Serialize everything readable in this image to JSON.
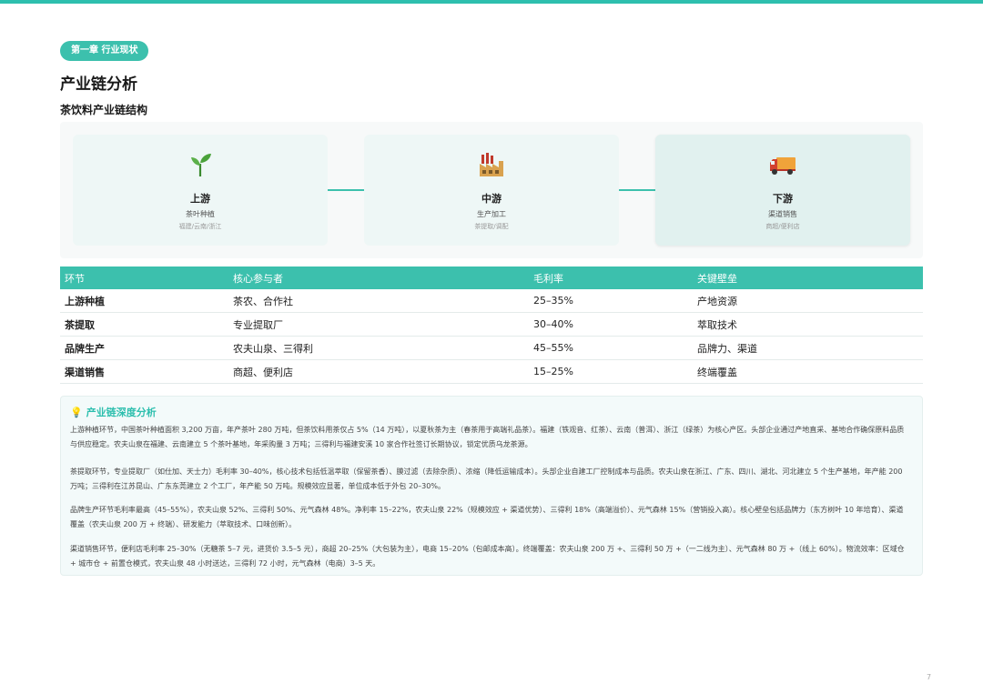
{
  "chapter_badge": "第一章 行业现状",
  "page_title": "产业链分析",
  "subtitle": "茶饮料产业链结构",
  "stages": [
    {
      "name": "上游",
      "desc": "茶叶种植",
      "regions": "福建/云南/浙江",
      "icon": "seedling-icon"
    },
    {
      "name": "中游",
      "desc": "生产加工",
      "regions": "茶提取/调配",
      "icon": "factory-icon"
    },
    {
      "name": "下游",
      "desc": "渠道销售",
      "regions": "商超/便利店",
      "icon": "delivery-truck-icon"
    }
  ],
  "table": {
    "headers": [
      "环节",
      "核心参与者",
      "毛利率",
      "关键壁垒"
    ],
    "rows": [
      [
        "上游种植",
        "茶农、合作社",
        "25–35%",
        "产地资源"
      ],
      [
        "茶提取",
        "专业提取厂",
        "30–40%",
        "萃取技术"
      ],
      [
        "品牌生产",
        "农夫山泉、三得利",
        "45–55%",
        "品牌力、渠道"
      ],
      [
        "渠道销售",
        "商超、便利店",
        "15–25%",
        "终端覆盖"
      ]
    ]
  },
  "analysis": {
    "title": "产业链深度分析",
    "paragraphs": [
      "上游种植环节，中国茶叶种植面积 3,200 万亩，年产茶叶 280 万吨，但茶饮料用茶仅占 5%（14 万吨），以夏秋茶为主（春茶用于高端礼品茶）。福建（铁观音、红茶）、云南（普洱）、浙江（绿茶）为核心产区。头部企业通过产地直采、基地合作确保原料品质与供应稳定。农夫山泉在福建、云南建立 5 个茶叶基地，年采购量 3 万吨；三得利与福建安溪 10 家合作社签订长期协议，锁定优质乌龙茶源。",
      "茶提取环节，专业提取厂（如仕加、天士力）毛利率 30–40%，核心技术包括低温萃取（保留茶香）、膜过滤（去除杂质）、浓缩（降低运输成本）。头部企业自建工厂控制成本与品质。农夫山泉在浙江、广东、四川、湖北、河北建立 5 个生产基地，年产能 200 万吨；三得利在江苏昆山、广东东莞建立 2 个工厂，年产能 50 万吨。规模效应显著，单位成本低于外包 20–30%。",
      "品牌生产环节毛利率最高（45–55%），农夫山泉 52%、三得利 50%、元气森林 48%。净利率 15–22%，农夫山泉 22%（规模效应 + 渠道优势）、三得利 18%（高端溢价）、元气森林 15%（营销投入高）。核心壁垒包括品牌力（东方树叶 10 年培育）、渠道覆盖（农夫山泉 200 万 + 终端）、研发能力（萃取技术、口味创新）。",
      "渠道销售环节，便利店毛利率 25–30%（无糖茶 5–7 元，进货价 3.5–5 元），商超 20–25%（大包装为主），电商 15–20%（包邮成本高）。终端覆盖：农夫山泉 200 万 +、三得利 50 万 +（一二线为主）、元气森林 80 万 +（线上 60%）。物流效率：区域仓 + 城市仓 + 前置仓模式，农夫山泉 48 小时送达，三得利 72 小时，元气森林（电商）3–5 天。"
    ]
  },
  "page_number": "7",
  "colors": {
    "accent": "#3cc0ad",
    "bulb": "#e8b93a"
  }
}
